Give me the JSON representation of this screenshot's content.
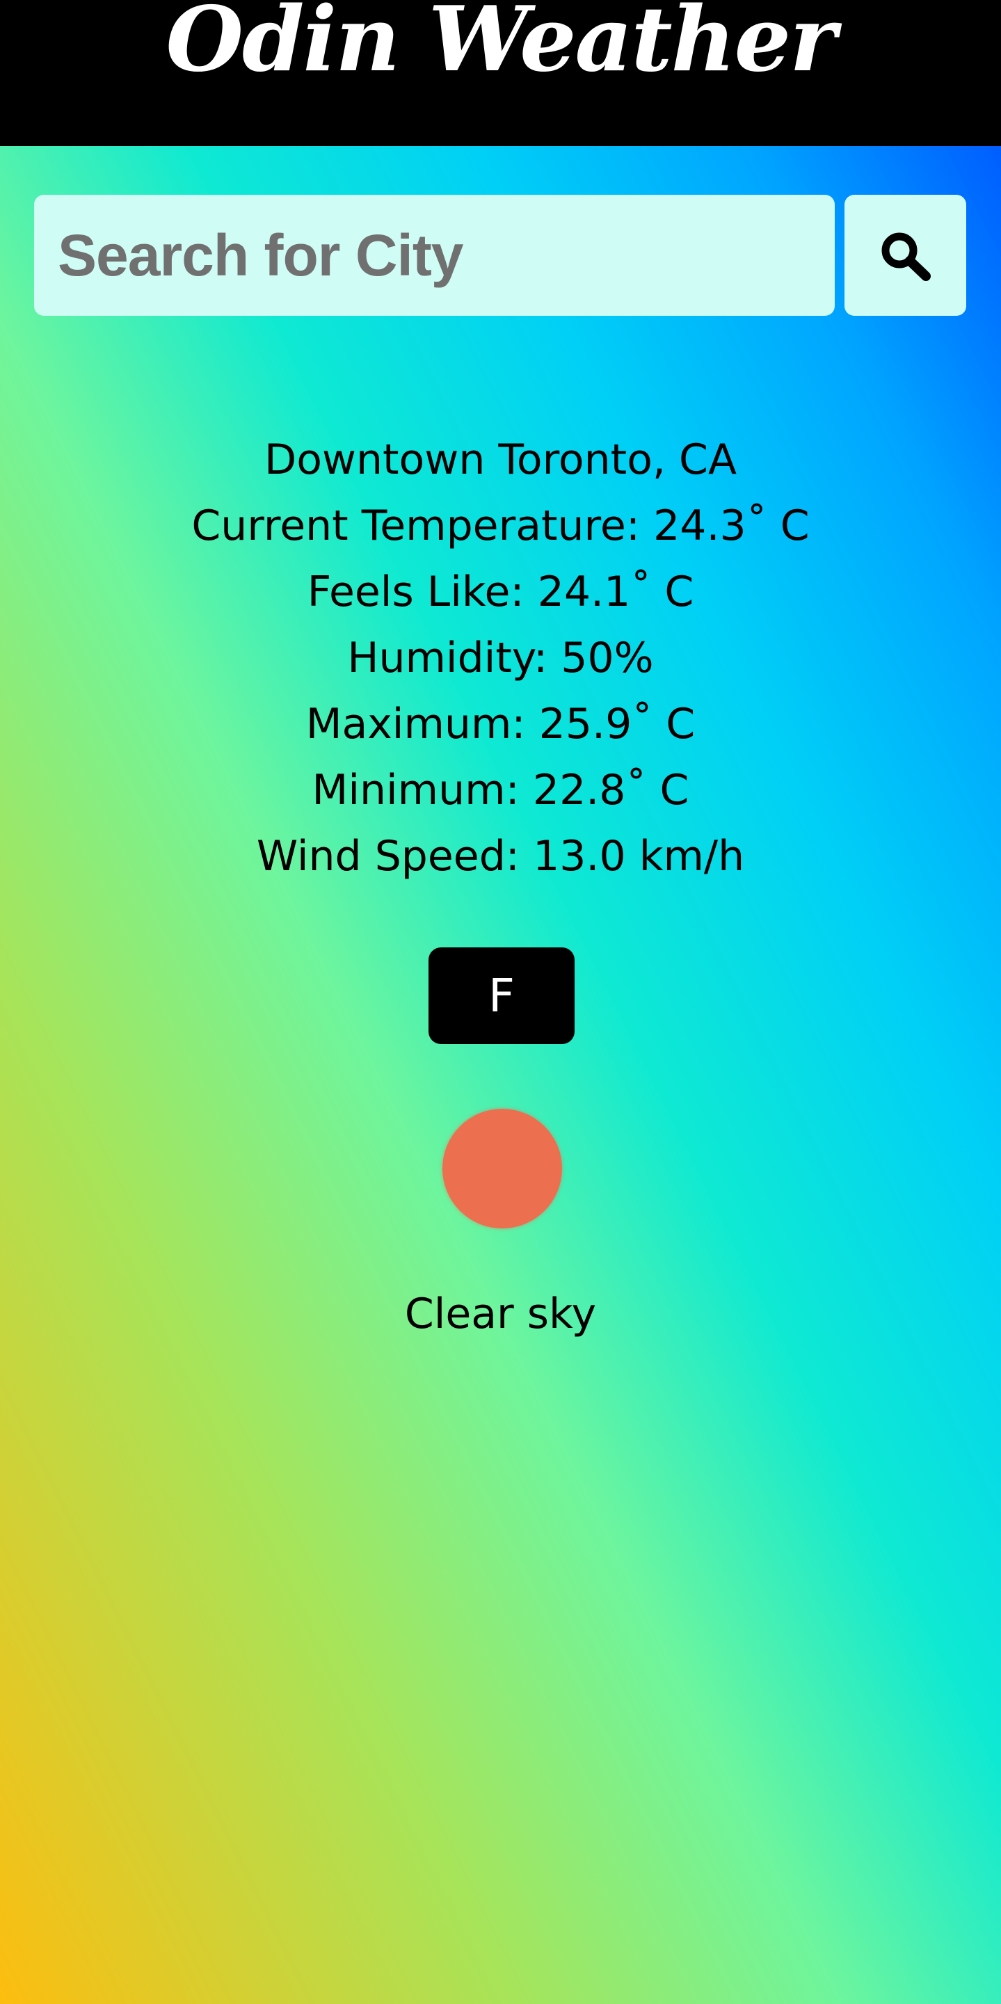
{
  "header": {
    "title": "Odin Weather"
  },
  "search": {
    "placeholder": "Search for City",
    "button_icon": "search-icon"
  },
  "weather": {
    "location": "Downtown Toronto, CA",
    "current_temperature": "Current Temperature: 24.3˚ C",
    "feels_like": "Feels Like: 24.1˚ C",
    "humidity": "Humidity: 50%",
    "maximum": "Maximum: 25.9˚ C",
    "minimum": "Minimum: 22.8˚ C",
    "wind_speed": "Wind Speed: 13.0 km/h",
    "description": "Clear sky",
    "icon": "sun-icon"
  },
  "unit_toggle": {
    "label": "F"
  },
  "colors": {
    "header_background": "#000000",
    "header_text": "#ffffff",
    "input_background": "#cffcf5",
    "sun": "#ec7050",
    "gradient_bottom_left": "#fdbd0f",
    "gradient_middle": "#6ef59d",
    "gradient_top_right": "#0048ff"
  }
}
